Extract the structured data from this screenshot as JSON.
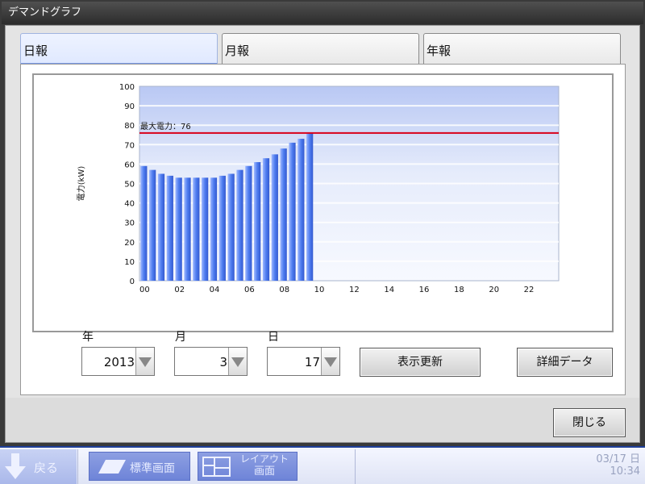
{
  "window": {
    "title": "デマンドグラフ"
  },
  "tabs": [
    {
      "label": "日報",
      "active": true
    },
    {
      "label": "月報",
      "active": false
    },
    {
      "label": "年報",
      "active": false
    }
  ],
  "chart_data": {
    "type": "bar",
    "title": "",
    "xlabel": "",
    "ylabel": "電力(kW)",
    "ylim": [
      0,
      100
    ],
    "y_ticks": [
      "0",
      "10",
      "20",
      "30",
      "40",
      "50",
      "60",
      "70",
      "80",
      "90",
      "100"
    ],
    "x_tick_labels": [
      "00",
      "02",
      "04",
      "06",
      "08",
      "10",
      "12",
      "14",
      "16",
      "18",
      "20",
      "22"
    ],
    "slots_per_day": 48,
    "values": [
      59,
      57,
      55,
      54,
      53,
      53,
      53,
      53,
      53,
      54,
      55,
      57,
      59,
      61,
      63,
      65,
      68,
      71,
      73,
      76
    ],
    "max_line": {
      "value": 76,
      "label": "最大電力：76",
      "color": "#d8001a"
    },
    "bar_color": "#4f7df0",
    "grid": true
  },
  "controls": {
    "year": {
      "label": "年",
      "value": "2013"
    },
    "month": {
      "label": "月",
      "value": "3"
    },
    "day": {
      "label": "日",
      "value": "17"
    },
    "refresh_label": "表示更新",
    "detail_label": "詳細データ",
    "close_label": "閉じる"
  },
  "taskbar": {
    "back_label": "戻る",
    "standard_label": "標準画面",
    "layout_label_1": "レイアウト",
    "layout_label_2": "画面",
    "date": "03/17 日",
    "time": "10:34"
  }
}
